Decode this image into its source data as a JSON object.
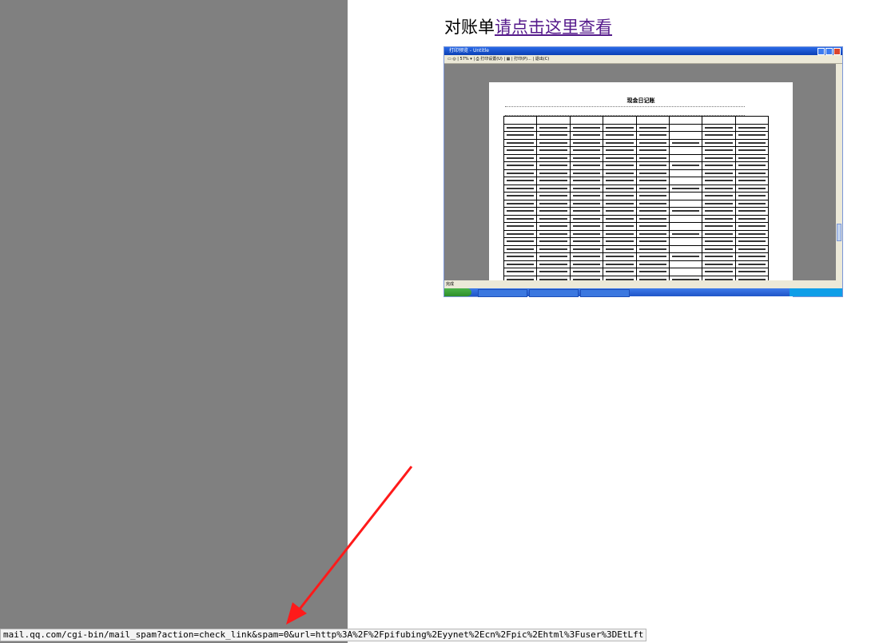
{
  "heading": {
    "prefix": "对账单",
    "link": "请点击这里查看"
  },
  "status_url": "mail.qq.com/cgi-bin/mail_spam?action=check_link&spam=0&url=http%3A%2F%2Fpifubing%2Eyynet%2Ecn%2Fpic%2Ehtml%3Fuser%3DEtLft",
  "colors": {
    "left_pane": "#808080",
    "link": "#551a8b",
    "arrow": "#ff1a1a"
  },
  "embedded_screenshot": {
    "window_title": "打印预览 - Untitle",
    "toolbar_text": "▭ ◎ | 57% ▾ | ⎙ 打印设置(U) | ▦ | 打印(P)... | 退出(C)",
    "status_text": "完成",
    "document_title": "现金日记账"
  }
}
